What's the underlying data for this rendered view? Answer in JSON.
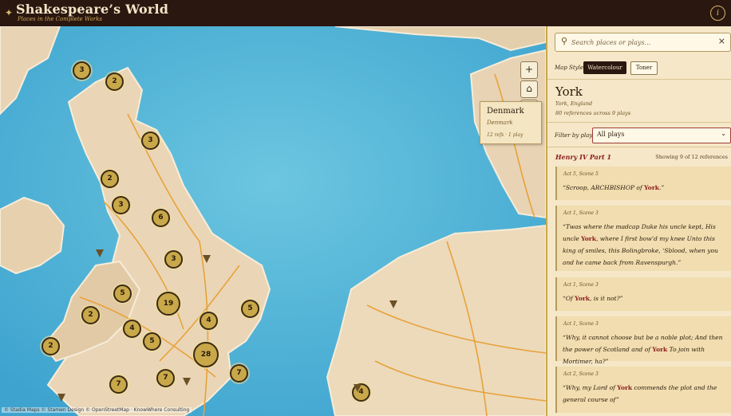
{
  "app": {
    "title": "Shakespeare’s World",
    "subtitle": "Places in the Complete Works"
  },
  "map": {
    "clusters": [
      3,
      2,
      3,
      2,
      3,
      6,
      3,
      5,
      19,
      2,
      4,
      4,
      5,
      5,
      28,
      2,
      7,
      7,
      7,
      4
    ],
    "zoom_in": "+",
    "home": "⌂",
    "zoom_out": "−",
    "popup": {
      "name": "Denmark",
      "country": "Denmark",
      "refs": "12 refs · 1 play"
    },
    "attribution": "© Stadia Maps © Stamen Design © OpenStreetMap · KnowWhere Consulting"
  },
  "panel": {
    "search_placeholder": "Search places or plays...",
    "clear": "×",
    "map_style_label": "Map Style:",
    "style_watercolour": "Watercolour",
    "style_toner": "Toner",
    "place": {
      "name": "York",
      "location": "York, England",
      "count": "80 references across 9 plays"
    },
    "filter_label": "Filter by play:",
    "filter_value": "All plays",
    "play_title": "Henry IV Part 1",
    "showing": "Showing 9 of 12 references",
    "quotes": [
      {
        "act": "Act 5, Scene 5",
        "before": "“Scroop, ARCHBISHOP of ",
        "kw": "York",
        "after": ".”"
      },
      {
        "act": "Act 1, Scene 3",
        "before": "“Twas where the madcap Duke his uncle kept, His uncle ",
        "kw": "York",
        "after": ", where I first bow’d my knee Unto this king of smiles, this Bolingbroke, ‘Sblood, when you and he came back from Ravenspurgh.”"
      },
      {
        "act": "Act 1, Scene 3",
        "before": "“Of ",
        "kw": "York",
        "after": ", is it not?”"
      },
      {
        "act": "Act 1, Scene 3",
        "before": "“Why, it cannot choose but be a noble plot; And then the power of Scotland and of ",
        "kw": "York",
        "after": " To join with Mortimer, ha?”"
      },
      {
        "act": "Act 2, Scene 3",
        "before": "“Why, my Lord of ",
        "kw": "York",
        "after": " commends the plot and the general course of”"
      }
    ]
  },
  "colors": {
    "accent": "#c9a84a",
    "brand": "#2a1710",
    "keyword": "#8b1c1c"
  }
}
